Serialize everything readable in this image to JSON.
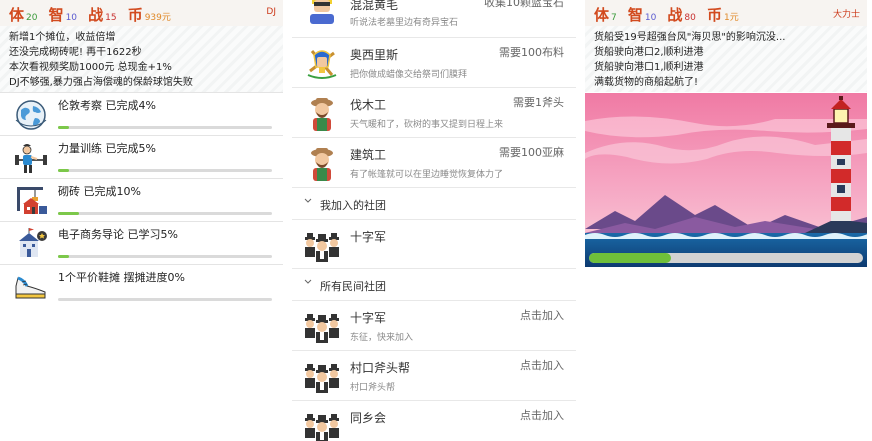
{
  "panel1": {
    "stats": {
      "ti_label": "体",
      "ti_value": "20",
      "zhi_label": "智",
      "zhi_value": "10",
      "zhan_label": "战",
      "zhan_value": "15",
      "bi_label": "币",
      "bi_value": "939元",
      "right_text": "DJ"
    },
    "news": [
      "新增1个摊位，收益倍增",
      "还没完成砌砖呢! 再干1622秒",
      "本次看视频奖励1000元 总现金+1%",
      "DJ不够强,暴力强占海偿魂的保龄球馆失败"
    ],
    "tasks": [
      {
        "label": "伦敦考察 已完成4%",
        "progress": 0.04,
        "icon": "globe-icon"
      },
      {
        "label": "力量训练 已完成5%",
        "progress": 0.05,
        "icon": "weightlifting-icon"
      },
      {
        "label": "砌砖 已完成10%",
        "progress": 0.1,
        "icon": "construction-crane-icon"
      },
      {
        "label": "电子商务导论 已学习5%",
        "progress": 0.05,
        "icon": "school-building-icon"
      },
      {
        "label": "1个平价鞋摊 摆摊进度0%",
        "progress": 0.0,
        "icon": "sneaker-icon"
      }
    ]
  },
  "panel2": {
    "top_row": {
      "name": "混混黄毛",
      "desc": "听说法老墓里边有奇异宝石",
      "req": "收集10颗蓝宝石"
    },
    "rows": [
      {
        "name": "奥西里斯",
        "desc": "把你做成蜡像交给祭司们膜拜",
        "req": "需要100布料",
        "icon": "pharaoh-icon"
      },
      {
        "name": "伐木工",
        "desc": "天气暖和了，砍树的事又提到日程上来",
        "req": "需要1斧头",
        "icon": "lumberjack-icon"
      },
      {
        "name": "建筑工",
        "desc": "有了帐篷就可以在里边睡觉恢复体力了",
        "req": "需要100亚麻",
        "icon": "builder-icon"
      }
    ],
    "joined_section": "我加入的社团",
    "joined": [
      {
        "name": "十字军",
        "icon": "gang-icon"
      }
    ],
    "all_section": "所有民间社团",
    "clubs": [
      {
        "name": "十字军",
        "desc": "东征，快来加入",
        "action": "点击加入"
      },
      {
        "name": "村口斧头帮",
        "desc": "村口斧头帮",
        "action": "点击加入"
      },
      {
        "name": "同乡会",
        "desc": "",
        "action": "点击加入"
      }
    ]
  },
  "panel3": {
    "stats": {
      "ti_label": "体",
      "ti_value": "7",
      "zhi_label": "智",
      "zhi_value": "10",
      "zhan_label": "战",
      "zhan_value": "80",
      "bi_label": "币",
      "bi_value": "1元",
      "right_text": "大力士"
    },
    "news": [
      "货船受19号超强台风\"海贝思\"的影响沉没...",
      "货船驶向港口2,顺利进港",
      "货船驶向港口1,顺利进港",
      "满载货物的商船起航了!"
    ],
    "scene_icon": "lighthouse-seascape-icon",
    "loading_progress": 0.3
  },
  "colors": {
    "accent": "#d24a1e",
    "progress": "#7cc84a",
    "divider": "#e4e4e4"
  }
}
